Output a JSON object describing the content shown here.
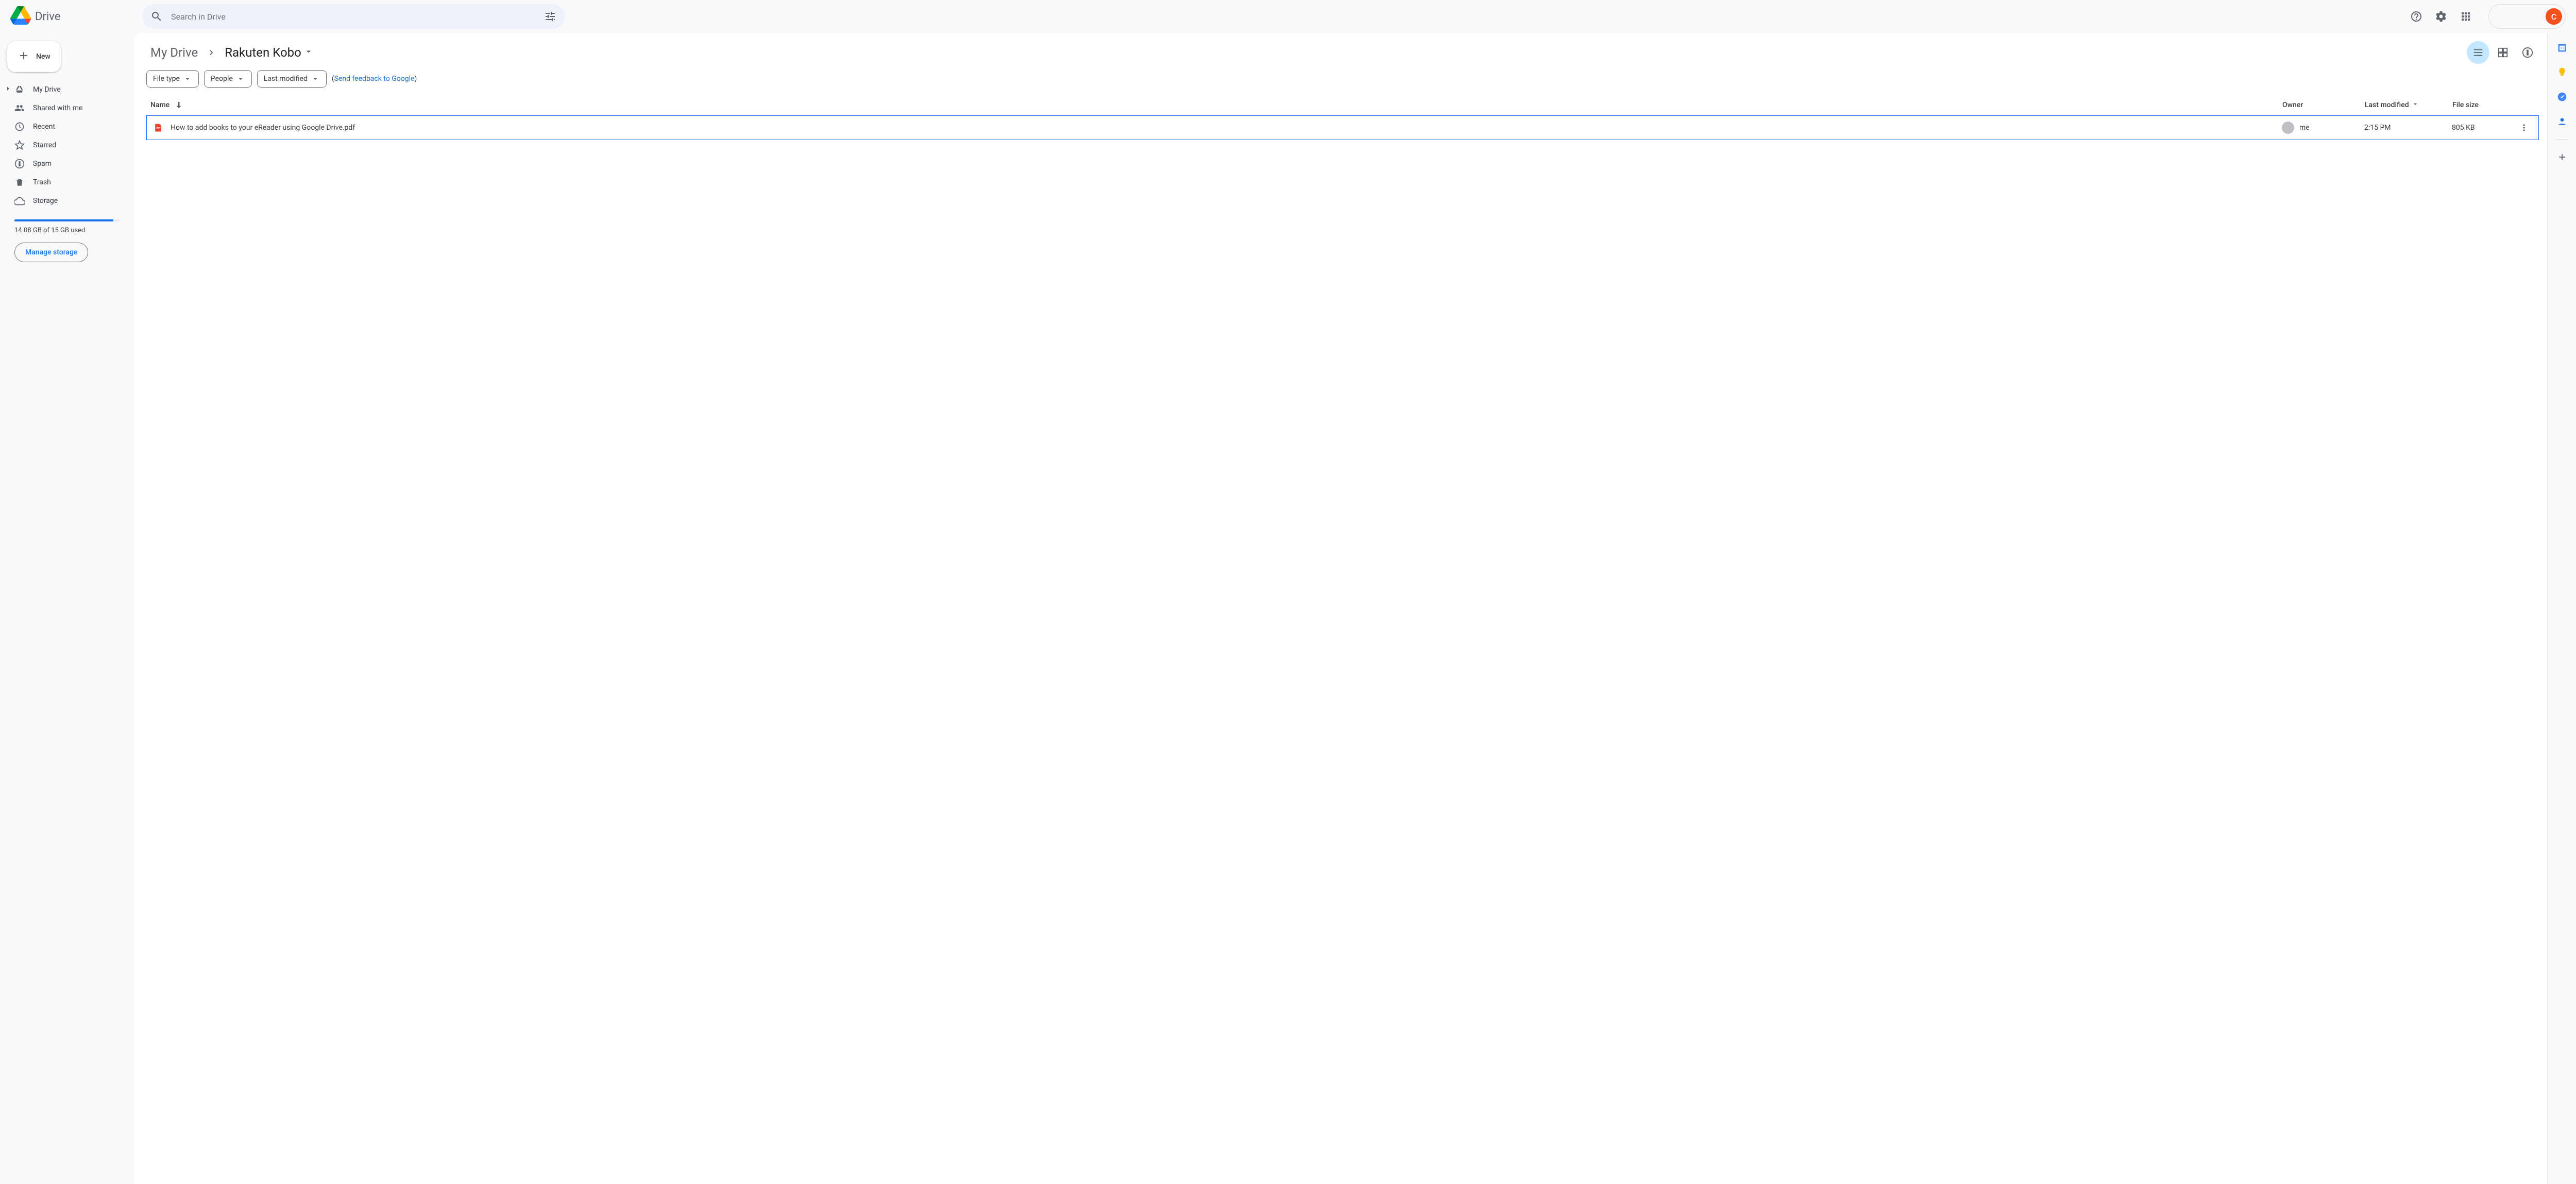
{
  "app": {
    "name": "Drive",
    "avatar_initial": "C"
  },
  "search": {
    "placeholder": "Search in Drive"
  },
  "sidebar": {
    "new_label": "New",
    "items": [
      {
        "label": "My Drive"
      },
      {
        "label": "Shared with me"
      },
      {
        "label": "Recent"
      },
      {
        "label": "Starred"
      },
      {
        "label": "Spam"
      },
      {
        "label": "Trash"
      },
      {
        "label": "Storage"
      }
    ],
    "storage": {
      "used_text": "14.08 GB of 15 GB used",
      "percent": 94,
      "manage_label": "Manage storage"
    }
  },
  "breadcrumb": {
    "root": "My Drive",
    "current": "Rakuten Kobo"
  },
  "filters": {
    "file_type": "File type",
    "people": "People",
    "last_modified": "Last modified",
    "feedback_open": "(",
    "feedback_link": "Send feedback to Google",
    "feedback_close": ")"
  },
  "table": {
    "headers": {
      "name": "Name",
      "owner": "Owner",
      "last_modified": "Last modified",
      "file_size": "File size"
    },
    "rows": [
      {
        "name": "How to add books to your eReader using Google Drive.pdf",
        "owner": "me",
        "last_modified": "2:15 PM",
        "size": "805 KB",
        "type": "pdf"
      }
    ]
  },
  "colors": {
    "accent": "#1a73e8",
    "pdf": "#ea4335",
    "avatar_bg": "#f4511e"
  }
}
